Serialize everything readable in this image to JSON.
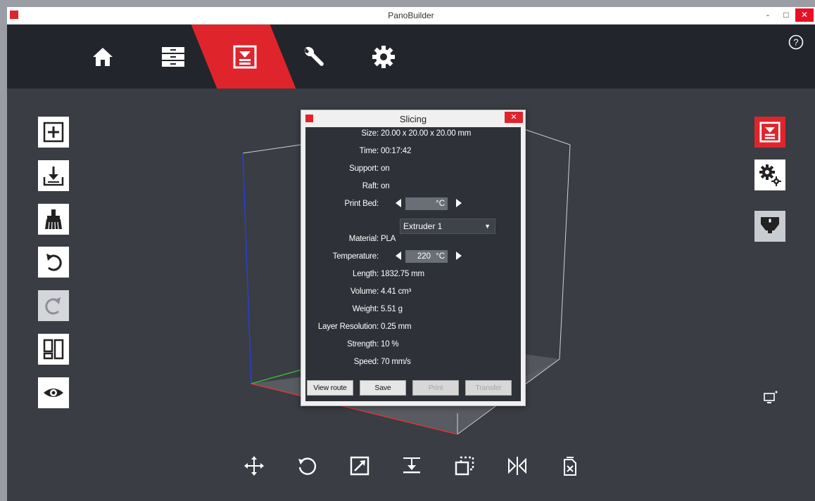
{
  "window": {
    "title": "PanoBuilder",
    "minimize": "-",
    "maximize": "□",
    "close": "✕"
  },
  "colors": {
    "accent": "#e0242c",
    "nav_bg": "#22252b",
    "canvas_bg": "#3a3d44",
    "dialog_bg": "#2e3138"
  },
  "topnav": [
    {
      "id": "home",
      "icon": "home-icon",
      "active": false
    },
    {
      "id": "library",
      "icon": "drawers-icon",
      "active": false
    },
    {
      "id": "slicing",
      "icon": "slicing-icon",
      "active": true
    },
    {
      "id": "tools",
      "icon": "wrench-icon",
      "active": false
    },
    {
      "id": "settings",
      "icon": "gear-icon",
      "active": false
    }
  ],
  "help": {
    "icon": "help-icon",
    "label": "?"
  },
  "left_toolbar": [
    {
      "icon": "add-model-icon",
      "disabled": false
    },
    {
      "icon": "import-icon",
      "disabled": false
    },
    {
      "icon": "clean-brush-icon",
      "disabled": false
    },
    {
      "icon": "undo-icon",
      "disabled": false
    },
    {
      "icon": "redo-icon",
      "disabled": true
    },
    {
      "icon": "layout-icon",
      "disabled": false
    },
    {
      "icon": "view-eye-icon",
      "disabled": false
    }
  ],
  "right_toolbar": [
    {
      "icon": "slicing-icon",
      "state": "active"
    },
    {
      "icon": "advanced-settings-icon",
      "state": "normal"
    },
    {
      "icon": "extruder-icon",
      "state": "grey"
    }
  ],
  "bottom_toolbar": [
    "move-icon",
    "rotate-icon",
    "scale-icon",
    "lay-flat-icon",
    "cut-icon",
    "mirror-icon",
    "delete-icon"
  ],
  "dialog": {
    "title": "Slicing",
    "close": "✕",
    "size": {
      "label": "Size:",
      "value": "20.00 x 20.00 x 20.00 mm"
    },
    "time": {
      "label": "Time:",
      "value": "00:17:42"
    },
    "support": {
      "label": "Support:",
      "value": "on"
    },
    "raft": {
      "label": "Raft:",
      "value": "on"
    },
    "print_bed": {
      "label": "Print Bed:",
      "value": "",
      "unit": "°C"
    },
    "extruder": {
      "selected": "Extruder 1"
    },
    "material": {
      "label": "Material:",
      "value": "PLA"
    },
    "temperature": {
      "label": "Temperature:",
      "value": "220",
      "unit": "°C"
    },
    "length": {
      "label": "Length:",
      "value": "1832.75 mm"
    },
    "volume": {
      "label": "Volume:",
      "value": "4.41 cm³"
    },
    "weight": {
      "label": "Weight:",
      "value": "5.51 g"
    },
    "layer_resolution": {
      "label": "Layer Resolution:",
      "value": "0.25 mm"
    },
    "strength": {
      "label": "Strength:",
      "value": "10 %"
    },
    "speed": {
      "label": "Speed:",
      "value": "70 mm/s"
    },
    "buttons": {
      "view_route": "View route",
      "save": "Save",
      "print": "Print",
      "transfer": "Transfer"
    }
  },
  "secondary_monitor": {
    "icon": "monitor-icon"
  }
}
